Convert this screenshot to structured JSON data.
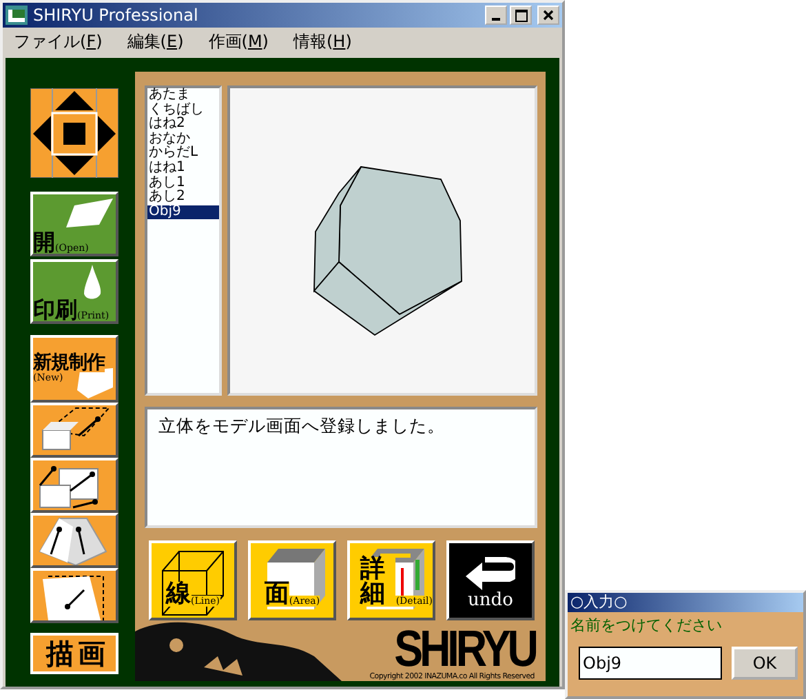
{
  "window": {
    "title": "SHIRYU Professional"
  },
  "menu": [
    {
      "label": "ファイル(F)"
    },
    {
      "label": "編集(E)"
    },
    {
      "label": "作画(M)"
    },
    {
      "label": "情報(H)"
    }
  ],
  "left_buttons": [
    {
      "kind": "open",
      "label": "開",
      "sub": "(Open)"
    },
    {
      "kind": "print",
      "label": "印刷",
      "sub": "(Print)"
    },
    {
      "kind": "new",
      "label": "新規制作",
      "sub": "(New)"
    }
  ],
  "tools": [
    {
      "kind": "stretch"
    },
    {
      "kind": "scale"
    },
    {
      "kind": "taper"
    },
    {
      "kind": "cut"
    }
  ],
  "mode_label": "描 画",
  "objects": [
    {
      "label": "あたま",
      "selected": false
    },
    {
      "label": "くちばし",
      "selected": false
    },
    {
      "label": "はね2",
      "selected": false
    },
    {
      "label": "おなか",
      "selected": false
    },
    {
      "label": "からだL",
      "selected": false
    },
    {
      "label": "はね1",
      "selected": false
    },
    {
      "label": "あし1",
      "selected": false
    },
    {
      "label": "あし2",
      "selected": false
    },
    {
      "label": "Obj9",
      "selected": true
    }
  ],
  "message": "立体をモデル画面へ登録しました。",
  "bottom_buttons": [
    {
      "kind": "line",
      "label": "線",
      "sub": "(Line)"
    },
    {
      "kind": "area",
      "label": "面",
      "sub": "(Area)"
    },
    {
      "kind": "detail",
      "label": "詳細",
      "sub": "(Detail)"
    },
    {
      "kind": "undo",
      "label": "undo"
    }
  ],
  "logo": "SHIRYU",
  "copyright": "Copyright 2002 INAZUMA.co All Rights Reserved",
  "dialog": {
    "title": "○入力○",
    "prompt": "名前をつけてください",
    "value": "Obj9",
    "button": "OK"
  }
}
